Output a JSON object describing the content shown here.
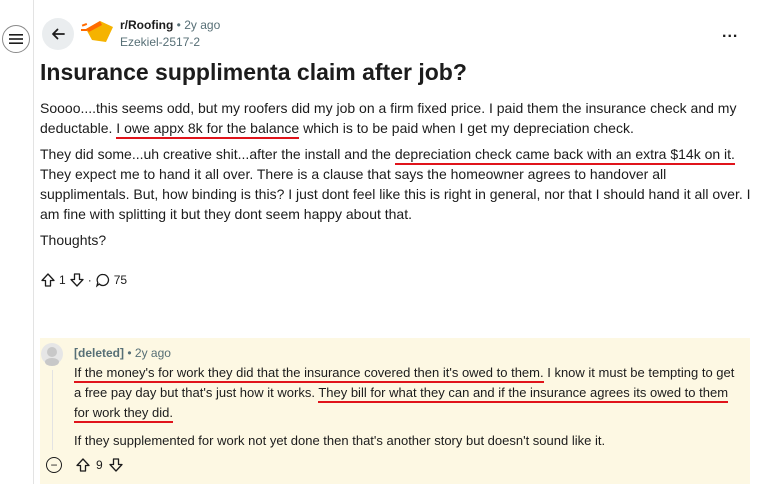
{
  "post": {
    "subreddit": "r/Roofing",
    "separator": "•",
    "time": "2y ago",
    "username": "Ezekiel-2517-2",
    "more_label": "...",
    "title": "Insurance supplimenta claim after job?",
    "p1_a": "Soooo....this seems odd, but my roofers did my job on a firm fixed price. I paid them the insurance check and my deductable. ",
    "p1_hl": "I owe appx 8k for the balance",
    "p1_b": " which is to be paid when I get my depreciation check.",
    "p2_a": "They did some...uh creative shit...after the install and the ",
    "p2_hl": "depreciation check came back with an extra $14k on it.",
    "p2_b": " They expect me to hand it all over. There is a clause that says the homeowner agrees to handover all supplimentals. But, how binding is this? I just dont feel like this is right in general, nor that I should hand it all over. I am fine with splitting it but they dont seem happy about that.",
    "p3": "Thoughts?",
    "votes": "1",
    "comments": "75",
    "action_sep": "·"
  },
  "comment": {
    "author": "[deleted]",
    "separator": "•",
    "time": "2y ago",
    "hl1": "If the money's for work they did that the insurance covered then it's owed to them.",
    "text1": " I know it must be tempting to get a free pay day but that's just how it works. ",
    "hl2": "They bill for what they can and if the insurance agrees its owed to them for work they did.",
    "p2": "If they supplemented for work not yet done then that's another story but doesn't sound like it.",
    "votes": "9",
    "collapse_label": "−"
  },
  "colors": {
    "underline": "#e0141b",
    "comment_bg": "#fdf8e3",
    "muted": "#576f76"
  },
  "icons": [
    "menu-icon",
    "back-arrow-icon",
    "subreddit-avatar-icon",
    "more-icon",
    "upvote-icon",
    "downvote-icon",
    "comment-icon",
    "deleted-avatar-icon",
    "collapse-icon"
  ]
}
